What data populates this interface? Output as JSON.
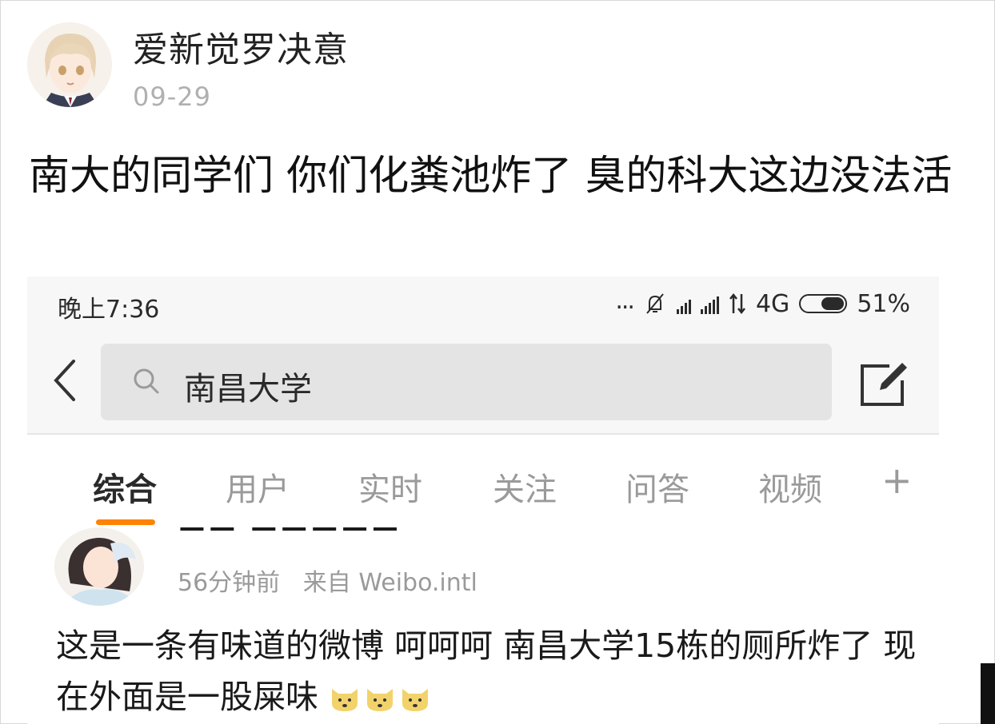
{
  "post": {
    "author": "爱新觉罗决意",
    "date": "09-29",
    "text": "南大的同学们 你们化粪池炸了 臭的科大这边没法活"
  },
  "screenshot": {
    "status_bar": {
      "time": "晚上7:36",
      "dots": "...",
      "network": "4G",
      "battery": "51%"
    },
    "search": {
      "query": "南昌大学"
    },
    "tabs": [
      {
        "label": "综合",
        "active": true
      },
      {
        "label": "用户"
      },
      {
        "label": "实时"
      },
      {
        "label": "关注"
      },
      {
        "label": "问答"
      },
      {
        "label": "视频"
      },
      {
        "label": "+"
      }
    ],
    "weibo": {
      "time_ago": "56分钟前",
      "source": "来自 Weibo.intl",
      "text": "这是一条有味道的微博 呵呵呵 南昌大学15栋的厕所炸了 现在外面是一股屎味"
    }
  },
  "colors": {
    "accent": "#ff8200",
    "muted": "#9a9a9a",
    "search_bg": "#e4e4e4"
  }
}
